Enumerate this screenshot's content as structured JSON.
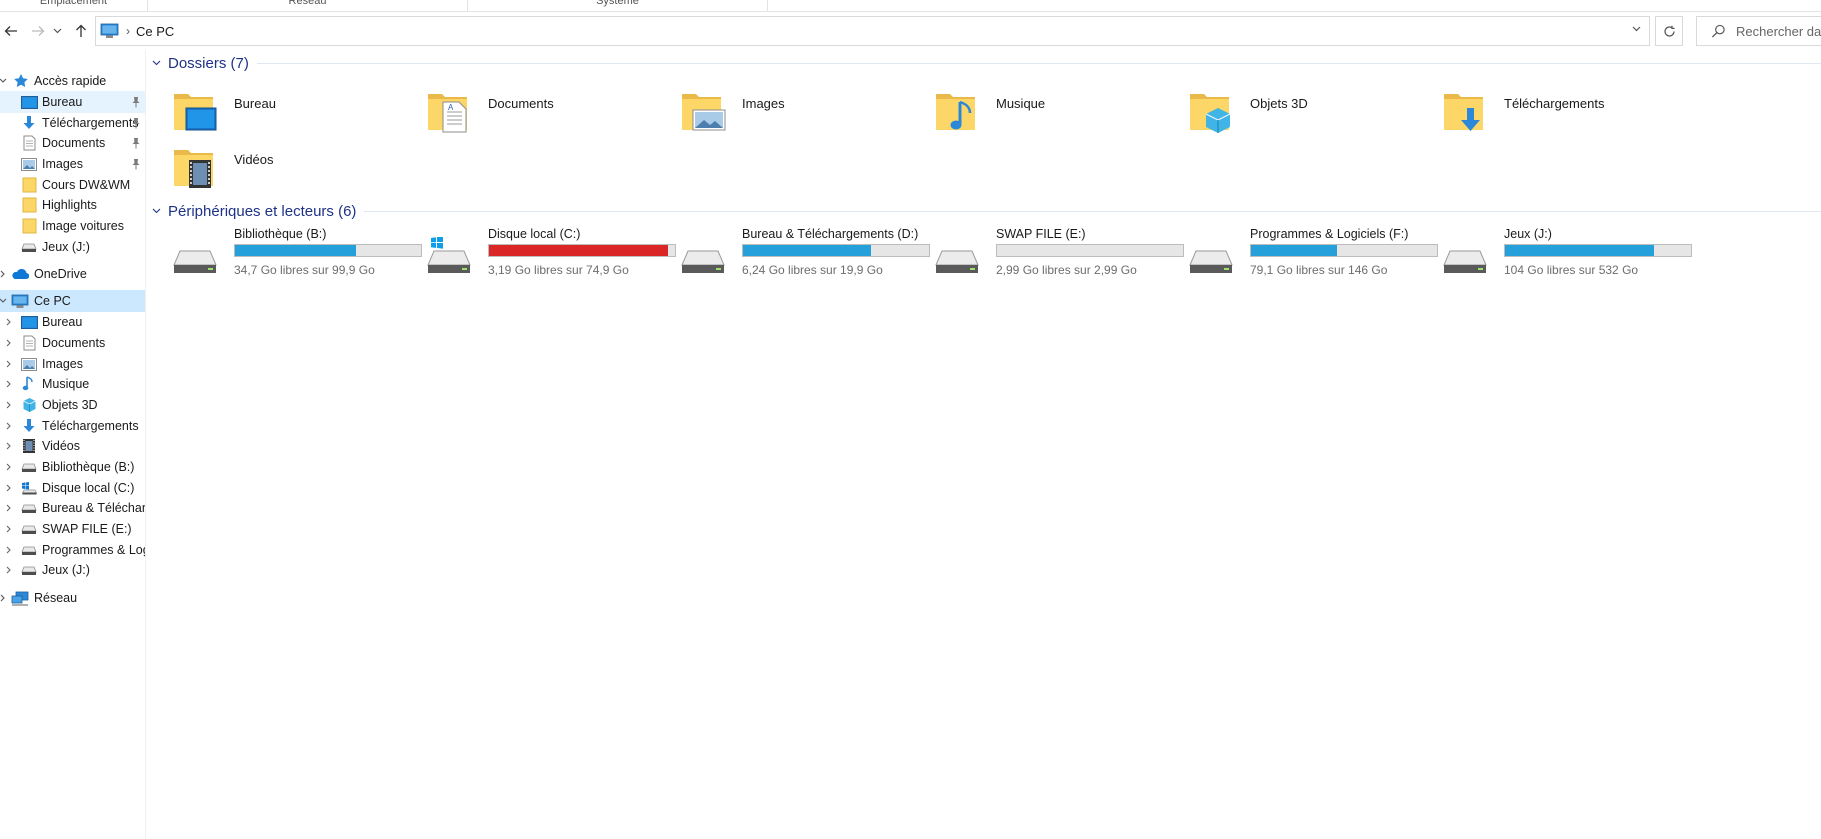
{
  "ribbon": {
    "groups": [
      "Emplacement",
      "Réseau",
      "Système"
    ]
  },
  "address": {
    "back_icon": "back-arrow-icon",
    "forward_icon": "forward-arrow-icon",
    "recent_icon": "chevron-down-icon",
    "up_icon": "up-arrow-icon",
    "location_icon": "this-pc-icon",
    "location": "Ce PC",
    "refresh_icon": "refresh-icon",
    "search_placeholder": "Rechercher dans"
  },
  "nav": {
    "quick_access": {
      "label": "Accès rapide",
      "items": [
        {
          "label": "Bureau",
          "icon": "desktop-icon",
          "pinned": true
        },
        {
          "label": "Téléchargements",
          "icon": "download-icon",
          "pinned": true
        },
        {
          "label": "Documents",
          "icon": "documents-icon",
          "pinned": true
        },
        {
          "label": "Images",
          "icon": "pictures-icon",
          "pinned": true
        },
        {
          "label": "Cours DW&WM",
          "icon": "folder-icon",
          "pinned": false
        },
        {
          "label": "Highlights",
          "icon": "folder-icon",
          "pinned": false
        },
        {
          "label": "Image voitures",
          "icon": "folder-icon",
          "pinned": false
        },
        {
          "label": "Jeux (J:)",
          "icon": "drive-icon",
          "pinned": false
        }
      ]
    },
    "onedrive": {
      "label": "OneDrive"
    },
    "this_pc": {
      "label": "Ce PC",
      "items": [
        {
          "label": "Bureau",
          "icon": "desktop-icon"
        },
        {
          "label": "Documents",
          "icon": "documents-icon"
        },
        {
          "label": "Images",
          "icon": "pictures-icon"
        },
        {
          "label": "Musique",
          "icon": "music-icon"
        },
        {
          "label": "Objets 3D",
          "icon": "3d-objects-icon"
        },
        {
          "label": "Téléchargements",
          "icon": "download-icon"
        },
        {
          "label": "Vidéos",
          "icon": "videos-icon"
        },
        {
          "label": "Bibliothèque (B:)",
          "icon": "drive-icon"
        },
        {
          "label": "Disque local (C:)",
          "icon": "windows-drive-icon"
        },
        {
          "label": "Bureau & Télécharg",
          "icon": "drive-icon"
        },
        {
          "label": "SWAP FILE (E:)",
          "icon": "drive-icon"
        },
        {
          "label": "Programmes & Log",
          "icon": "drive-icon"
        },
        {
          "label": "Jeux (J:)",
          "icon": "drive-icon"
        }
      ]
    },
    "network": {
      "label": "Réseau"
    }
  },
  "content": {
    "folders_header": "Dossiers (7)",
    "folders": [
      {
        "name": "Bureau",
        "icon": "desktop-folder-icon"
      },
      {
        "name": "Documents",
        "icon": "documents-folder-icon"
      },
      {
        "name": "Images",
        "icon": "pictures-folder-icon"
      },
      {
        "name": "Musique",
        "icon": "music-folder-icon"
      },
      {
        "name": "Objets 3D",
        "icon": "3d-objects-folder-icon"
      },
      {
        "name": "Téléchargements",
        "icon": "downloads-folder-icon"
      },
      {
        "name": "Vidéos",
        "icon": "videos-folder-icon"
      }
    ],
    "drives_header": "Périphériques et lecteurs (6)",
    "drives": [
      {
        "name": "Bibliothèque (B:)",
        "free": "34,7 Go libres sur 99,9 Go",
        "used_fraction": 0.65,
        "bar_color": "#26a0da",
        "windows": false
      },
      {
        "name": "Disque local (C:)",
        "free": "3,19 Go libres sur 74,9 Go",
        "used_fraction": 0.96,
        "bar_color": "#da2626",
        "windows": true
      },
      {
        "name": "Bureau & Téléchargements (D:)",
        "free": "6,24 Go libres sur 19,9 Go",
        "used_fraction": 0.69,
        "bar_color": "#26a0da",
        "windows": false
      },
      {
        "name": "SWAP FILE (E:)",
        "free": "2,99 Go libres sur 2,99 Go",
        "used_fraction": 0.0,
        "bar_color": "#26a0da",
        "windows": false
      },
      {
        "name": "Programmes & Logiciels (F:)",
        "free": "79,1 Go libres sur 146 Go",
        "used_fraction": 0.46,
        "bar_color": "#26a0da",
        "windows": false
      },
      {
        "name": "Jeux (J:)",
        "free": "104 Go libres sur 532 Go",
        "used_fraction": 0.8,
        "bar_color": "#26a0da",
        "windows": false
      }
    ]
  },
  "colors": {
    "accent": "#26a0da",
    "critical": "#da2626",
    "selection": "#cce8ff",
    "header_text": "#1e3287"
  }
}
